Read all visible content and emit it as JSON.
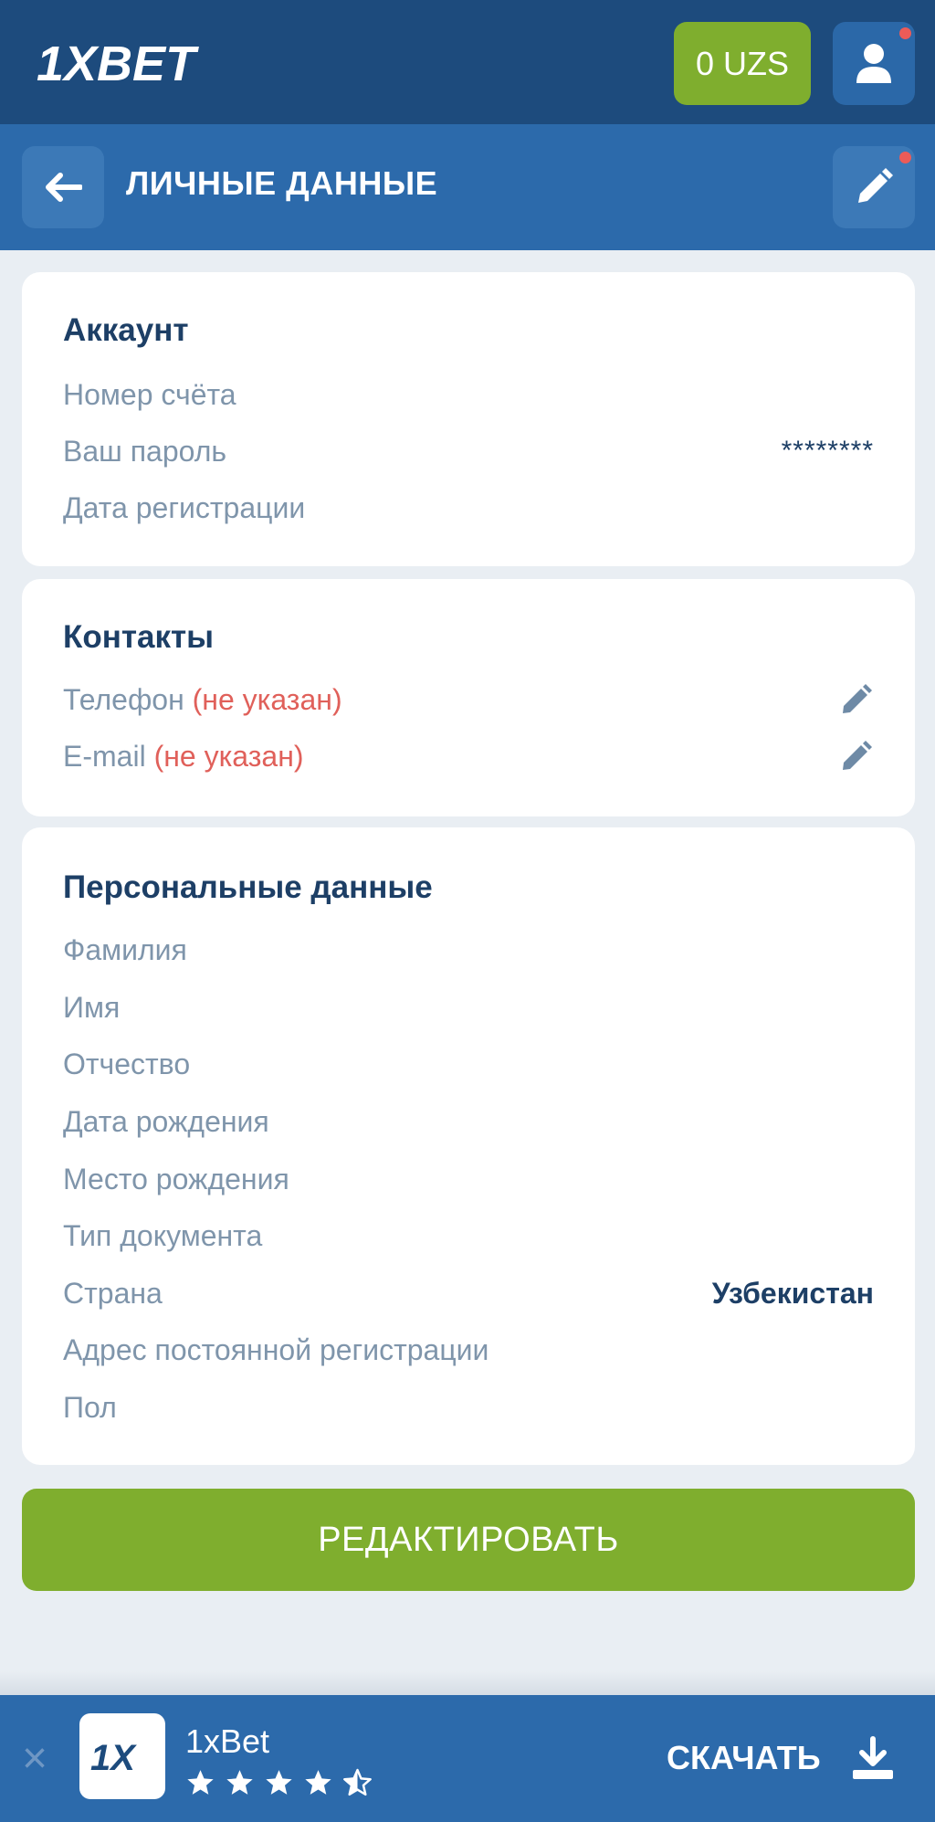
{
  "header": {
    "brand": "1XBET",
    "balance": "0 UZS",
    "accent_color": "#7fae2e",
    "notification_color": "#ec5b58"
  },
  "subheader": {
    "title": "ЛИЧНЫЕ ДАННЫЕ"
  },
  "account": {
    "title": "Аккаунт",
    "account_number_label": "Номер счёта",
    "password_label": "Ваш пароль",
    "password_value": "********",
    "registration_date_label": "Дата регистрации"
  },
  "contacts": {
    "title": "Контакты",
    "phone_label": "Телефон",
    "phone_status": "(не указан)",
    "email_label": "E-mail",
    "email_status": "(не указан)"
  },
  "personal": {
    "title": "Персональные данные",
    "surname_label": "Фамилия",
    "name_label": "Имя",
    "patronymic_label": "Отчество",
    "birth_date_label": "Дата рождения",
    "birth_place_label": "Место рождения",
    "document_type_label": "Тип документа",
    "country_label": "Страна",
    "country_value": "Узбекистан",
    "address_label": "Адрес постоянной регистрации",
    "gender_label": "Пол"
  },
  "actions": {
    "edit_label": "РЕДАКТИРОВАТЬ"
  },
  "app_banner": {
    "app_name": "1xBet",
    "rating": 4.5,
    "download_label": "СКАЧАТЬ",
    "icon_text": "1X"
  }
}
